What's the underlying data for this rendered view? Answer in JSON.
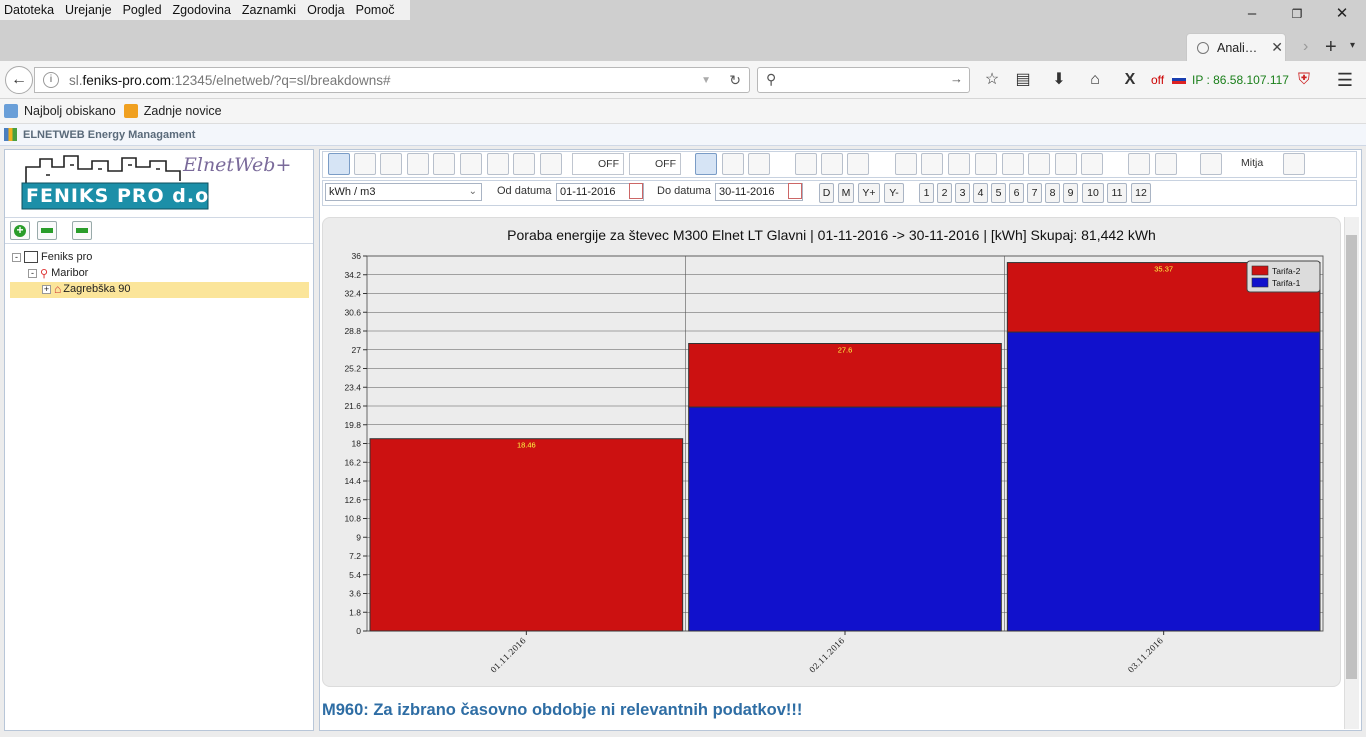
{
  "browser": {
    "menu": [
      "Datoteka",
      "Urejanje",
      "Pogled",
      "Zgodovina",
      "Zaznamki",
      "Orodja",
      "Pomoč"
    ],
    "tab_title": "Anali…",
    "url_prefix": "sl.",
    "url_domain": "feniks-pro.com",
    "url_rest": ":12345/elnetweb/?q=sl/breakdowns#",
    "off_label": "off",
    "ip_label": "IP : 86.58.107.117",
    "bookmarks": [
      "Najbolj obiskano",
      "Zadnje novice"
    ]
  },
  "app": {
    "title": "ELNETWEB Energy Managament",
    "logo_company": "FENIKS PRO d.o.o.",
    "logo_script": "ElnetWeb+",
    "tree": {
      "root": "Feniks pro",
      "child": "Maribor",
      "leaf": "Zagrebška 90"
    },
    "toolbar": {
      "off1": "OFF",
      "off2": "OFF",
      "user": "Mitja"
    },
    "filters": {
      "unit": "kWh / m3",
      "from_label": "Od datuma",
      "from_value": "01-11-2016",
      "to_label": "Do datuma",
      "to_value": "30-11-2016",
      "period_buttons": [
        "D",
        "M",
        "Y+",
        "Y-"
      ],
      "month_buttons": [
        "1",
        "2",
        "3",
        "4",
        "5",
        "6",
        "7",
        "8",
        "9",
        "10",
        "11",
        "12"
      ]
    },
    "message": "M960: Za izbrano časovno obdobje ni relevantnih podatkov!!!"
  },
  "colors": {
    "tarifa2": "#cc1111",
    "tarifa1": "#1111cc",
    "label": "#ffff44"
  },
  "chart_data": {
    "type": "bar",
    "stacked": true,
    "title": "Poraba energije za števec M300 Elnet LT Glavni | 01-11-2016 -> 30-11-2016 | [kWh] Skupaj: 81,442 kWh",
    "categories": [
      "01.11.2016",
      "02.11.2016",
      "03.11.2016"
    ],
    "series": [
      {
        "name": "Tarifa-1",
        "values": [
          0,
          21.5,
          28.7
        ]
      },
      {
        "name": "Tarifa-2",
        "values": [
          18.46,
          6.1,
          6.67
        ]
      }
    ],
    "totals_labels": [
      "18.46",
      "27.6",
      "35.37"
    ],
    "y_ticks": [
      "0",
      "1.8",
      "3.6",
      "5.4",
      "7.2",
      "9",
      "10.8",
      "12.6",
      "14.4",
      "16.2",
      "18",
      "19.8",
      "21.6",
      "23.4",
      "25.2",
      "27",
      "28.8",
      "30.6",
      "32.4",
      "34.2",
      "36"
    ],
    "ylim": [
      0,
      36
    ],
    "legend_position": "top-right",
    "grid": true
  }
}
